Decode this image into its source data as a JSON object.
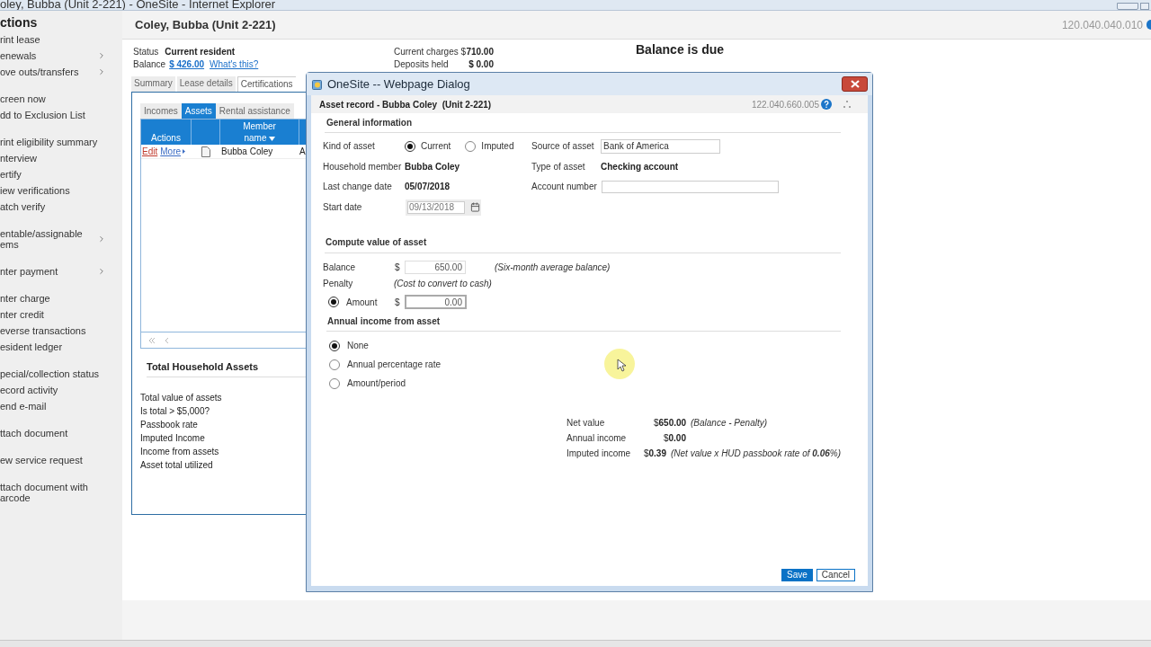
{
  "browser": {
    "title": "oley, Bubba (Unit 2-221) - OneSite - Internet Explorer"
  },
  "sidebar": {
    "title": "ctions",
    "groups": [
      [
        {
          "label": "rint lease",
          "submenu": false
        },
        {
          "label": "enewals",
          "submenu": true
        },
        {
          "label": "ove outs/transfers",
          "submenu": true
        }
      ],
      [
        {
          "label": "creen now",
          "submenu": false
        },
        {
          "label": "dd to Exclusion List",
          "submenu": false
        }
      ],
      [
        {
          "label": "rint eligibility summary",
          "submenu": false
        },
        {
          "label": "nterview",
          "submenu": false
        },
        {
          "label": "ertify",
          "submenu": false
        },
        {
          "label": "iew verifications",
          "submenu": false
        },
        {
          "label": "atch verify",
          "submenu": false
        }
      ],
      [
        {
          "label": "entable/assignable\nems",
          "submenu": true
        }
      ],
      [
        {
          "label": "nter payment",
          "submenu": true
        }
      ],
      [
        {
          "label": "nter charge",
          "submenu": false
        },
        {
          "label": "nter credit",
          "submenu": false
        },
        {
          "label": "everse transactions",
          "submenu": false
        },
        {
          "label": "esident ledger",
          "submenu": false
        }
      ],
      [
        {
          "label": "pecial/collection status",
          "submenu": false
        },
        {
          "label": "ecord activity",
          "submenu": false
        },
        {
          "label": "end e-mail",
          "submenu": false
        }
      ],
      [
        {
          "label": "ttach document",
          "submenu": false
        }
      ],
      [
        {
          "label": "ew service request",
          "submenu": false
        }
      ],
      [
        {
          "label": "ttach document with\narcode",
          "submenu": false
        }
      ]
    ]
  },
  "header": {
    "title": "Coley, Bubba (Unit 2-221)",
    "version": "120.040.040.010"
  },
  "status": {
    "status_label": "Status",
    "status_value": "Current resident",
    "balance_label": "Balance",
    "balance_value": "$ 426.00",
    "balance_help": "What's this?",
    "charges": [
      {
        "label": "Current charges $",
        "value": "710.00"
      },
      {
        "label": "Deposits held",
        "value": "$ 0.00"
      }
    ],
    "notice": "Balance is due"
  },
  "tabs": [
    {
      "label": "Summary",
      "selected": false
    },
    {
      "label": "Lease details",
      "selected": false
    },
    {
      "label": "Certifications",
      "selected": true
    }
  ],
  "panel": {
    "subtabs": [
      {
        "label": "Incomes",
        "selected": false
      },
      {
        "label": "Assets",
        "selected": true
      },
      {
        "label": "Rental assistance",
        "selected": false
      }
    ],
    "columns": [
      {
        "label": "Actions",
        "sorted": false
      },
      {
        "label": "Member name",
        "sorted": true
      }
    ],
    "rows": [
      {
        "links": [
          "Edit",
          "More"
        ],
        "member": "Bubba Coley",
        "column_4": "A"
      }
    ],
    "totals": {
      "title": "Total Household Assets",
      "labels": [
        "Total value of assets",
        "Is total > $5,000?",
        "Passbook rate",
        "Imputed Income",
        "Income from assets",
        "Asset total utilized"
      ]
    }
  },
  "dialog": {
    "title": "OneSite -- Webpage Dialog",
    "subtitle": "Asset record - Bubba Coley  (Unit 2-221)",
    "version": "122.040.660.005",
    "general": {
      "title": "General information",
      "kind_label": "Kind of asset",
      "kind_options": [
        {
          "label": "Current",
          "selected": true
        },
        {
          "label": "Imputed",
          "selected": false
        }
      ],
      "source_label": "Source of asset",
      "source_value": "Bank of America",
      "member_label": "Household member",
      "member_value": "Bubba Coley",
      "type_label": "Type of asset",
      "type_value": "Checking account",
      "last_change_label": "Last change date",
      "last_change_value": "05/07/2018",
      "account_label": "Account number",
      "start_label": "Start date",
      "start_value": "09/13/2018"
    },
    "compute": {
      "title": "Compute value of asset",
      "balance_label": "Balance",
      "currency": "$",
      "balance_value": "650.00",
      "balance_note": "(Six-month average balance)",
      "penalty_label": "Penalty",
      "penalty_note": "(Cost to convert to cash)",
      "penalty_options": [
        {
          "label": "Amount",
          "selected": true,
          "currency": "$",
          "value": "0.00"
        }
      ]
    },
    "income": {
      "title": "Annual income from asset",
      "options": [
        {
          "label": "None",
          "selected": true
        },
        {
          "label": "Annual percentage rate",
          "selected": false
        },
        {
          "label": "Amount/period",
          "selected": false
        }
      ]
    },
    "summary": [
      {
        "label": "Net value",
        "value": "$**650.00**",
        "note": "(Balance - Penalty)"
      },
      {
        "label": "Annual income",
        "value": "$**0.00**"
      },
      {
        "label": "Imputed income",
        "value": "$**0.39**",
        "note": "(Net value x HUD passbook rate of **0.06**%)"
      }
    ],
    "buttons": [
      {
        "label": "Save",
        "kind": "primary"
      },
      {
        "label": "Cancel",
        "kind": "secondary"
      }
    ]
  }
}
